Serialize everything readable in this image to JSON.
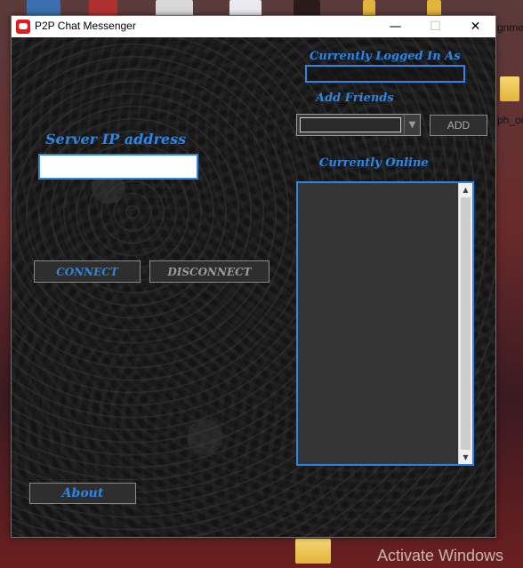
{
  "desktop": {
    "file_tail_1": "gnme",
    "file_tail_2": "ph_ou",
    "watermark": "Activate Windows"
  },
  "window": {
    "title": "P2P Chat Messenger",
    "controls": {
      "minimize_glyph": "—",
      "maximize_glyph": "☐",
      "close_glyph": "✕"
    }
  },
  "app": {
    "logged_in_label": "Currently Logged In As",
    "logged_in_value": "",
    "add_friends_label": "Add Friends",
    "friend_select_value": "",
    "add_button": "ADD",
    "server_ip_label": "Server IP address",
    "server_ip_value": "",
    "currently_online_label": "Currently Online",
    "online_users": [],
    "connect_button": "CONNECT",
    "disconnect_button": "DISCONNECT",
    "about_button": "About"
  },
  "icons": {
    "app": "chat-bubble-icon",
    "dropdown": "chevron-down-icon",
    "scroll_up": "triangle-up-icon",
    "scroll_down": "triangle-down-icon"
  },
  "colors": {
    "accent": "#2a86e8",
    "disabled_text": "#9a9a9a",
    "titlebar": "#ffffff",
    "app_icon": "#e01d1d"
  }
}
